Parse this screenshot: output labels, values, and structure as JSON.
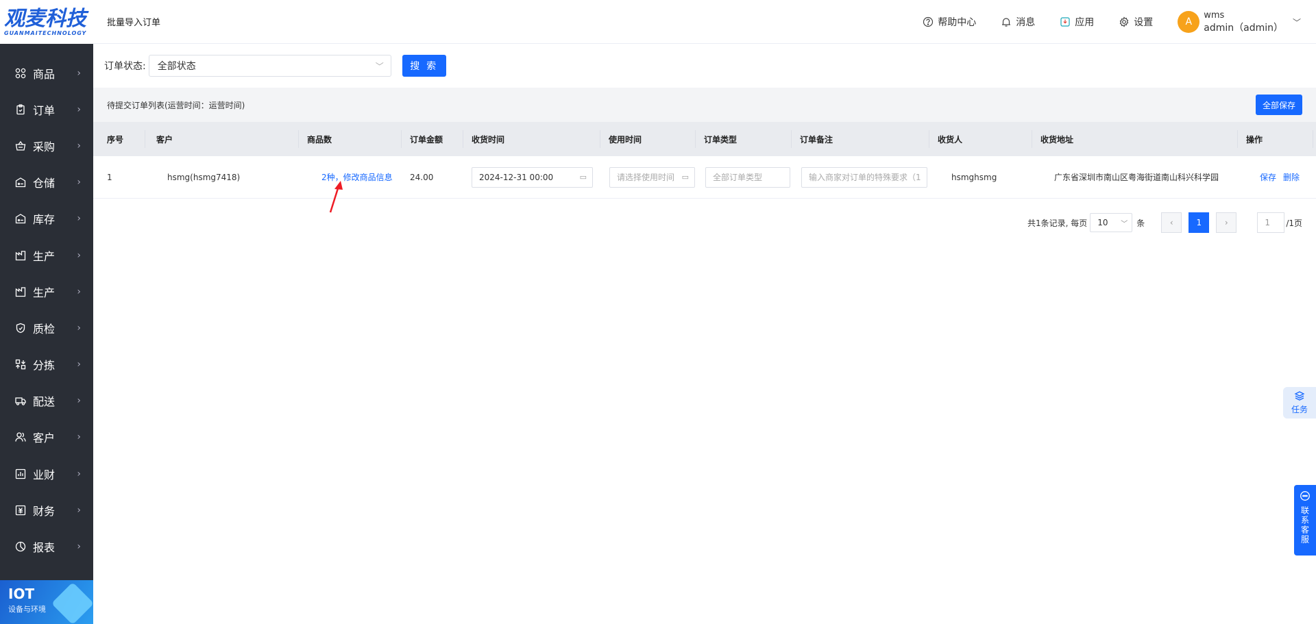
{
  "brand": {
    "name_cn": "观麦科技",
    "name_en": "GUANMAITECHNOLOGY"
  },
  "sidebar": {
    "items": [
      {
        "label": "商品",
        "icon": "grid-icon"
      },
      {
        "label": "订单",
        "icon": "clipboard-icon"
      },
      {
        "label": "采购",
        "icon": "basket-icon"
      },
      {
        "label": "仓储",
        "icon": "warehouse-icon"
      },
      {
        "label": "库存",
        "icon": "warehouse-icon"
      },
      {
        "label": "生产",
        "icon": "factory-icon"
      },
      {
        "label": "生产",
        "icon": "factory-icon"
      },
      {
        "label": "质检",
        "icon": "shield-icon"
      },
      {
        "label": "分拣",
        "icon": "sort-icon"
      },
      {
        "label": "配送",
        "icon": "truck-icon"
      },
      {
        "label": "客户",
        "icon": "users-icon"
      },
      {
        "label": "业财",
        "icon": "chart-icon"
      },
      {
        "label": "财务",
        "icon": "finance-icon"
      },
      {
        "label": "报表",
        "icon": "pie-icon"
      }
    ],
    "iot": {
      "title": "IOT",
      "subtitle": "设备与环境"
    }
  },
  "header": {
    "breadcrumb": "批量导入订单",
    "tools": [
      {
        "label": "帮助中心",
        "icon": "help-icon"
      },
      {
        "label": "消息",
        "icon": "bell-icon"
      },
      {
        "label": "应用",
        "icon": "app-icon"
      },
      {
        "label": "设置",
        "icon": "gear-icon"
      }
    ],
    "user": {
      "avatar": "A",
      "name": "wms",
      "account": "admin（admin）"
    }
  },
  "filter": {
    "label": "订单状态:",
    "status_value": "全部状态",
    "search_label": "搜 索"
  },
  "list": {
    "title": "待提交订单列表(运营时间：运营时间)",
    "save_all_label": "全部保存",
    "columns": [
      "序号",
      "客户",
      "商品数",
      "订单金额",
      "收货时间",
      "使用时间",
      "订单类型",
      "订单备注",
      "收货人",
      "收货地址",
      "操作"
    ],
    "rows": [
      {
        "index": "1",
        "customer": "hsmg(hsmg7418)",
        "goods": "2种，修改商品信息",
        "amount": "24.00",
        "receive_time": "2024-12-31 00:00",
        "use_time_placeholder": "请选择使用时间",
        "order_type_placeholder": "全部订单类型",
        "remark_placeholder": "输入商家对订单的特殊要求（1",
        "receiver": "hsmghsmg",
        "address": "广东省深圳市南山区粤海街道南山科兴科学园",
        "actions": {
          "save": "保存",
          "delete": "删除"
        }
      }
    ]
  },
  "pagination": {
    "summary": "共1条记录, 每页",
    "page_size": "10",
    "unit": "条",
    "prev": "‹",
    "current_page": "1",
    "next": "›",
    "jump_value": "1",
    "total_pages": "/1页"
  },
  "floating": {
    "task_label": "任务",
    "cs_label": "联系客服"
  },
  "colors": {
    "primary": "#1769ff",
    "sidebar": "#2a2e36",
    "avatar": "#f7a21b"
  }
}
